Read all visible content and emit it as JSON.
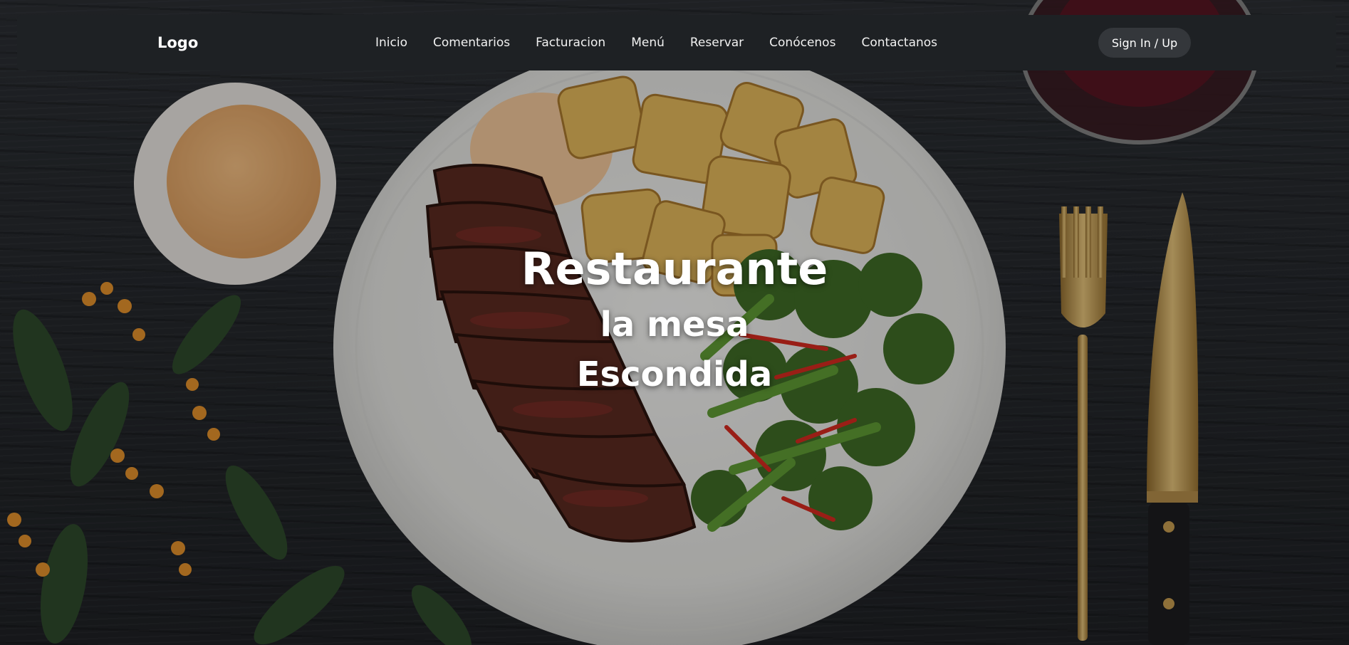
{
  "nav": {
    "logo": "Logo",
    "links": [
      "Inicio",
      "Comentarios",
      "Facturacion",
      "Menú",
      "Reservar",
      "Conócenos",
      "Contactanos"
    ],
    "sign_button": "Sign In / Up"
  },
  "hero": {
    "title_line1": "Restaurante",
    "title_line2": "la mesa",
    "title_line3": "Escondida",
    "background_description_icon": "steak-plate-image"
  },
  "colors": {
    "navbar_bg": "#1e2124",
    "button_bg": "#34373b",
    "text": "#ffffff"
  }
}
